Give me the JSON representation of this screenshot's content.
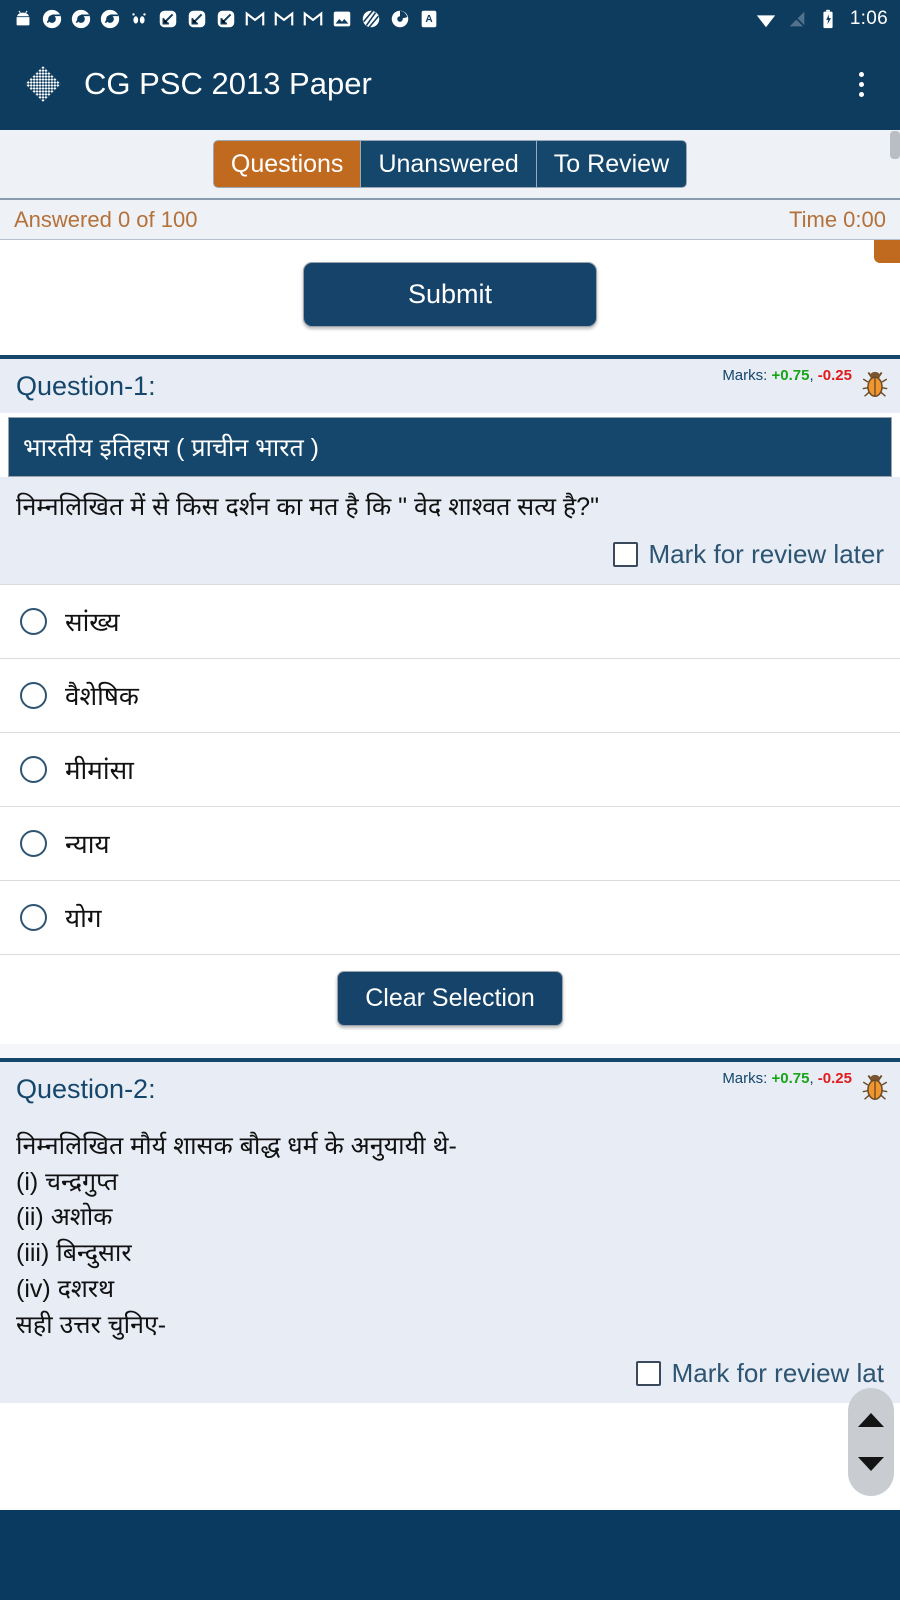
{
  "statusbar": {
    "icons": [
      "android-icon",
      "chrome-icon",
      "chrome-icon",
      "chrome-icon",
      "footprints-icon",
      "note-icon",
      "note-icon",
      "note-icon",
      "gmail-icon",
      "gmail-icon",
      "gmail-icon",
      "photo-icon",
      "slashed-circle-icon",
      "loading-circle-icon",
      "translate-icon"
    ],
    "right_icons": [
      "wifi-icon",
      "no-signal-icon",
      "battery-charging-icon"
    ],
    "clock": "1:06"
  },
  "appbar": {
    "logo": "diamond-mesh-logo",
    "title": "CG PSC 2013 Paper",
    "overflow": "overflow-menu-icon"
  },
  "tabs": [
    {
      "label": "Questions",
      "active": true,
      "color": "#c06a1f"
    },
    {
      "label": "Unanswered",
      "active": false,
      "color": "#15466b"
    },
    {
      "label": "To Review",
      "active": false,
      "color": "#15466b"
    }
  ],
  "status_row": {
    "answered": "Answered 0 of 100",
    "time": "Time 0:00",
    "color": "#b5713a"
  },
  "toolbar": {
    "submit_label": "Submit",
    "clear_label": "Clear Selection"
  },
  "common": {
    "marks_prefix": "Marks:",
    "marks_positive": "+0.75",
    "marks_separator": ",",
    "marks_negative": "-0.25",
    "review_label": "Mark for review later",
    "review_label_clipped": "Mark for review lat",
    "bug_icon": "bug-icon"
  },
  "questions": [
    {
      "title": "Question-1:",
      "subject": "भारतीय इतिहास ( प्राचीन भारत )",
      "text": "निम्नलिखित में से किस दर्शन का मत है कि \" वेद शाश्वत सत्य है?\"",
      "options": [
        "सांख्य",
        "वैशेषिक",
        "मीमांसा",
        "न्याय",
        "योग"
      ]
    },
    {
      "title": "Question-2:",
      "lines": [
        "निम्नलिखित मौर्य शासक बौद्ध धर्म के अनुयायी थे-",
        "(i) चन्द्रगुप्त",
        "(ii) अशोक",
        "(iii) बिन्दुसार",
        "(iv) दशरथ",
        "सही उत्तर चुनिए-"
      ]
    }
  ],
  "scroll_widget": {
    "up": "scroll-up-arrow-icon",
    "down": "scroll-down-arrow-icon"
  },
  "colors": {
    "primary": "#15466b",
    "accent": "#c06a1f",
    "status_text": "#b5713a",
    "positive": "#19a319",
    "negative": "#e01b1b"
  }
}
